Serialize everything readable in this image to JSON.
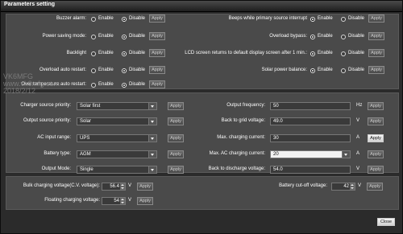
{
  "window": {
    "title": "Parameters setting"
  },
  "options": {
    "enable": "Enable",
    "disable": "Disable"
  },
  "apply": "Apply",
  "watermark": [
    "VK6MFG",
    "www.vk6mfg.com",
    "2018/2/12"
  ],
  "radio_left": [
    {
      "label": "Buzzer alarm:",
      "selected": "disable"
    },
    {
      "label": "Power saving mode:",
      "selected": "disable"
    },
    {
      "label": "Backlight",
      "selected": "disable"
    },
    {
      "label": "Overload auto restart:",
      "selected": "disable"
    },
    {
      "label": "Over temperature auto restart:",
      "selected": "disable"
    }
  ],
  "radio_right": [
    {
      "label": "Beeps while primary source interrupt",
      "selected": "enable"
    },
    {
      "label": "Overload bypass:",
      "selected": "enable"
    },
    {
      "label": "LCD screen returns to default display screen after 1 min.:",
      "selected": "enable"
    },
    {
      "label": "Solar power balance:",
      "selected": "enable"
    }
  ],
  "select_left": [
    {
      "label": "Charger source priority:",
      "value": "Solar first"
    },
    {
      "label": "Output source priority:",
      "value": "Solar"
    },
    {
      "label": "AC input range:",
      "value": "UPS"
    },
    {
      "label": "Battery type:",
      "value": "AGM"
    },
    {
      "label": "Output Mode:",
      "value": "Single"
    }
  ],
  "select_right": [
    {
      "label": "Output frequency:",
      "value": "50",
      "unit": "Hz"
    },
    {
      "label": "Back to grid voltage:",
      "value": "49.0",
      "unit": "V"
    },
    {
      "label": "Max. charging current:",
      "value": "30",
      "unit": "A"
    },
    {
      "label": "Max. AC charging current:",
      "value": "20",
      "unit": "A"
    },
    {
      "label": "Back to discharge voltage:",
      "value": "54.0",
      "unit": "V"
    }
  ],
  "voltages": {
    "bulk": {
      "label": "Bulk charging voltage(C.V. voltage):",
      "value": "56.4",
      "unit": "V"
    },
    "floating": {
      "label": "Floating charging voltage:",
      "value": "54",
      "unit": "V"
    },
    "cutoff": {
      "label": "Battery cut-off voltage:",
      "value": "42",
      "unit": "V"
    }
  },
  "close": "Close"
}
